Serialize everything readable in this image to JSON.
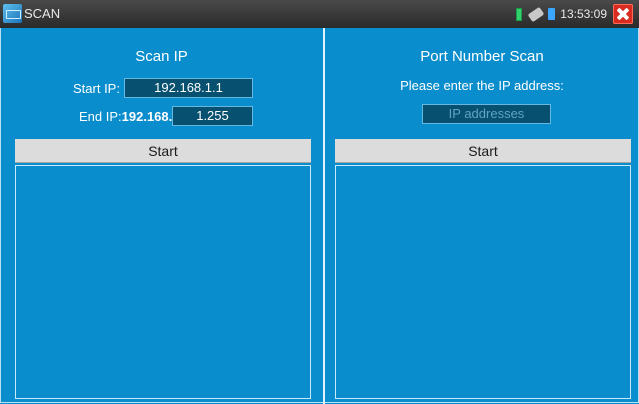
{
  "window": {
    "title": "SCAN"
  },
  "status_bar": {
    "time": "13:53:09"
  },
  "scan_ip": {
    "heading": "Scan IP",
    "start_label": "Start IP:",
    "start_value": "192.168.1.1",
    "end_label": "End IP:",
    "end_prefix": "192.168.",
    "end_value": "1.255",
    "start_button": "Start"
  },
  "port_scan": {
    "heading": "Port Number Scan",
    "prompt": "Please enter the IP address:",
    "ip_placeholder": "IP addresses",
    "start_button": "Start"
  }
}
